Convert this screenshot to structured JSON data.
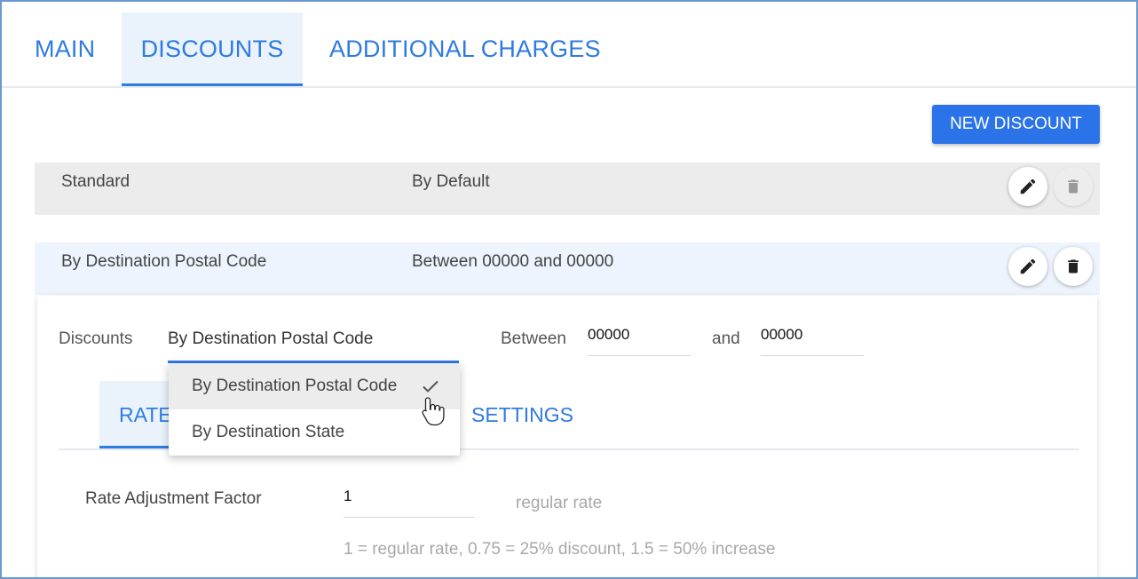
{
  "tabs": {
    "main": "MAIN",
    "discounts": "DISCOUNTS",
    "additional_charges": "ADDITIONAL CHARGES",
    "active": "DISCOUNTS"
  },
  "toolbar": {
    "new_discount": "NEW DISCOUNT"
  },
  "discount_rows": [
    {
      "type": "Standard",
      "condition": "By Default",
      "delete_enabled": false
    },
    {
      "type": "By Destination Postal Code",
      "condition": "Between 00000 and 00000",
      "delete_enabled": true
    }
  ],
  "editor": {
    "discounts_label": "Discounts",
    "selected_type": "By Destination Postal Code",
    "between_label": "Between",
    "from_value": "00000",
    "and_label": "and",
    "to_value": "00000",
    "subtabs": {
      "rate": "RATE",
      "settings": "SETTINGS"
    },
    "rate_adjustment_label": "Rate Adjustment Factor",
    "rate_adjustment_value": "1",
    "rate_suffix": "regular rate",
    "rate_hint": "1 = regular rate, 0.75 = 25% discount, 1.5 = 50% increase"
  },
  "dropdown": {
    "options": [
      "By Destination Postal Code",
      "By Destination State"
    ],
    "selected_index": 0
  },
  "colors": {
    "accent": "#2f7be0",
    "button": "#2a73e8",
    "row_standard": "#ececec",
    "row_selected": "#eef4fd"
  }
}
